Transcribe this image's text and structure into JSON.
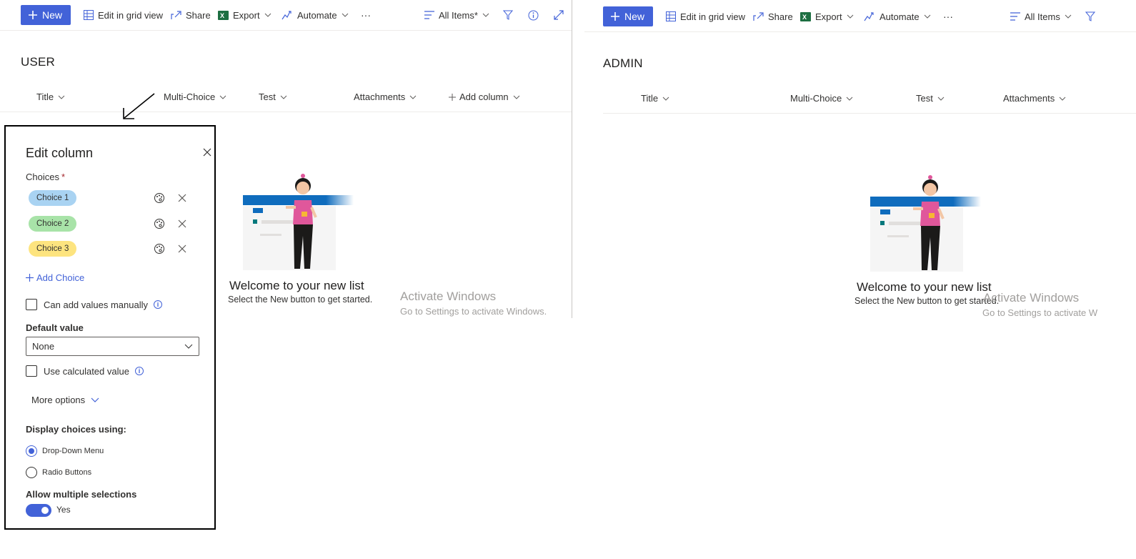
{
  "user_view": {
    "toolbar": {
      "new_label": "New",
      "grid_label": "Edit in grid view",
      "share_label": "Share",
      "export_label": "Export",
      "automate_label": "Automate",
      "more_label": "···",
      "view_label": "All Items*"
    },
    "list_title": "USER",
    "columns": [
      "Title",
      "Multi-Choice",
      "Test",
      "Attachments"
    ],
    "add_column_label": "Add column",
    "empty_title": "Welcome to your new list",
    "empty_subtitle": "Select the New button to get started.",
    "watermark_title": "Activate Windows",
    "watermark_sub": "Go to Settings to activate Windows."
  },
  "admin_view": {
    "toolbar": {
      "new_label": "New",
      "grid_label": "Edit in grid view",
      "share_label": "Share",
      "export_label": "Export",
      "automate_label": "Automate",
      "more_label": "···",
      "view_label": "All Items"
    },
    "list_title": "ADMIN",
    "columns": [
      "Title",
      "Multi-Choice",
      "Test",
      "Attachments"
    ],
    "empty_title": "Welcome to your new list",
    "empty_subtitle": "Select the New button to get started.",
    "watermark_title": "Activate Windows",
    "watermark_sub": "Go to Settings to activate W"
  },
  "edit_panel": {
    "title": "Edit column",
    "choices_label": "Choices",
    "required_mark": "*",
    "choices": [
      {
        "label": "Choice 1",
        "color": "#a9d3f2"
      },
      {
        "label": "Choice 2",
        "color": "#a8e3a8"
      },
      {
        "label": "Choice 3",
        "color": "#fde47f"
      }
    ],
    "add_choice_label": "Add Choice",
    "manual_values_label": "Can add values manually",
    "default_value_label": "Default value",
    "default_value": "None",
    "calculated_label": "Use calculated value",
    "more_options_label": "More options",
    "display_label": "Display choices using:",
    "display_options": [
      {
        "label": "Drop-Down Menu",
        "selected": true
      },
      {
        "label": "Radio Buttons",
        "selected": false
      }
    ],
    "multi_label": "Allow multiple selections",
    "multi_value": "Yes"
  },
  "colors": {
    "accent": "#4262d8",
    "excel_green": "#1d6f42",
    "illus_blue": "#0f6cbd",
    "illus_pink": "#e0579b"
  }
}
